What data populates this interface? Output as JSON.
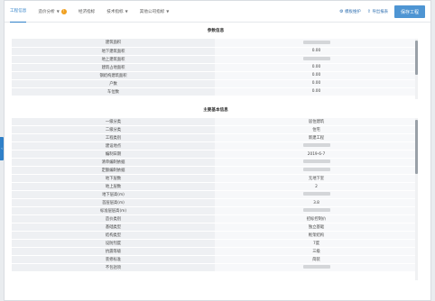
{
  "tabs": [
    {
      "label": "工程信息",
      "active": true,
      "caret": false,
      "warn": false
    },
    {
      "label": "造价分析",
      "active": false,
      "caret": true,
      "warn": true
    },
    {
      "label": "经济指标",
      "active": false,
      "caret": false,
      "warn": false
    },
    {
      "label": "技术指标",
      "active": false,
      "caret": true,
      "warn": false
    },
    {
      "label": "其他公司指标",
      "active": false,
      "caret": true,
      "warn": false
    }
  ],
  "actions": {
    "link1": "模板维护",
    "link2": "导出报表",
    "save": "保存工程"
  },
  "section1": {
    "title": "参数信息",
    "rows": [
      {
        "label": "建筑面积",
        "value": ""
      },
      {
        "label": "地下建筑面积",
        "value": "0.00"
      },
      {
        "label": "地上建筑面积",
        "value": ""
      },
      {
        "label": "建筑占地面积",
        "value": "0.00"
      },
      {
        "label": "钢结构建筑面积",
        "value": "0.00"
      },
      {
        "label": "户数",
        "value": "0.00"
      },
      {
        "label": "车位数",
        "value": "0.00"
      }
    ]
  },
  "section2": {
    "title": "主要基本信息",
    "rows": [
      {
        "label": "一级分类",
        "value": "居住建筑"
      },
      {
        "label": "二级分类",
        "value": "住宅"
      },
      {
        "label": "工程类别",
        "value": "新建工程"
      },
      {
        "label": "建设地点",
        "value": ""
      },
      {
        "label": "编制日期",
        "value": "2019-6-7"
      },
      {
        "label": "清单编制依据",
        "value": ""
      },
      {
        "label": "定额编制依据",
        "value": ""
      },
      {
        "label": "地下层数",
        "value": "无地下室"
      },
      {
        "label": "地上层数",
        "value": "2"
      },
      {
        "label": "地下层高(m)",
        "value": ""
      },
      {
        "label": "首层层高(m)",
        "value": "3.8"
      },
      {
        "label": "标准层层高(m)",
        "value": ""
      },
      {
        "label": "造价类别",
        "value": "招标控制价"
      },
      {
        "label": "基础类型",
        "value": "独立基础"
      },
      {
        "label": "结构类型",
        "value": "框架结构"
      },
      {
        "label": "设防烈度",
        "value": "7度"
      },
      {
        "label": "抗震等级",
        "value": "三级"
      },
      {
        "label": "装修标准",
        "value": "简装"
      },
      {
        "label": "不包括项",
        "value": ""
      }
    ]
  },
  "icons": {
    "settings": "gear-icon",
    "export": "export-icon",
    "collapse": "chevron-left-icon"
  },
  "colors": {
    "accent": "#2f80c8",
    "save_button": "#4e95d3",
    "label_cell": "#eef0f3",
    "value_cell": "#f7f8fa"
  }
}
